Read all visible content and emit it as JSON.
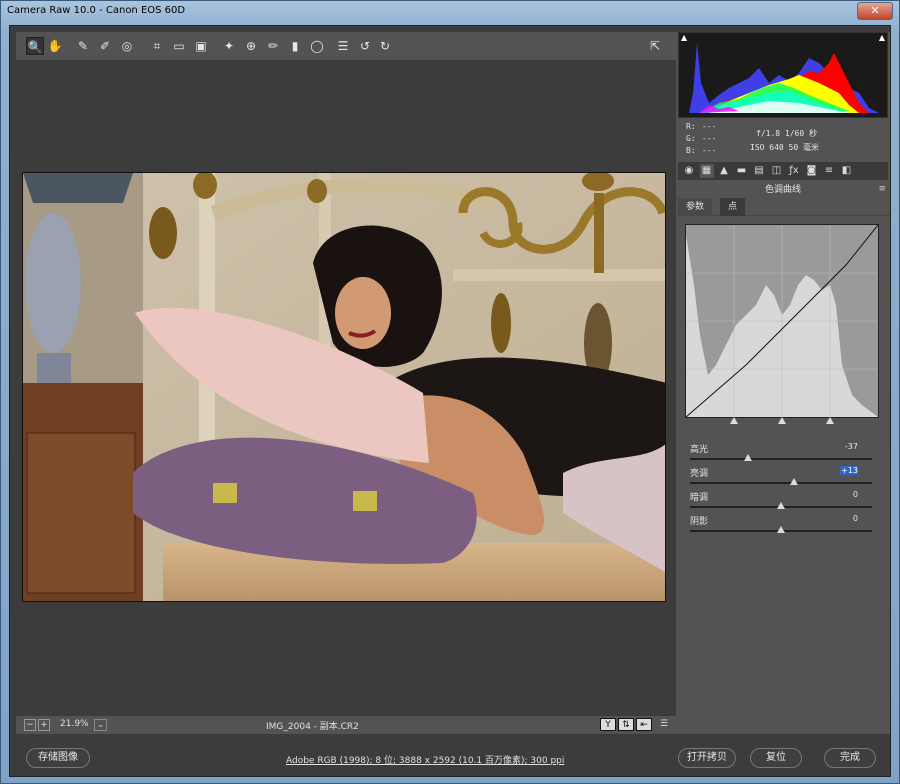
{
  "window": {
    "title": "Camera Raw 10.0 - Canon EOS 60D",
    "close_glyph": "✕"
  },
  "toolbar": {
    "tools": [
      "zoom-icon",
      "hand-icon",
      "white-balance-icon",
      "color-sampler-icon",
      "target-adjust-icon",
      "crop-icon",
      "straighten-icon",
      "transform-icon",
      "spot-removal-icon",
      "red-eye-icon",
      "adjustment-brush-icon",
      "graduated-filter-icon",
      "radial-filter-icon",
      "preferences-icon",
      "rotate-left-icon",
      "rotate-right-icon"
    ],
    "glyphs": [
      "🔍",
      "✋",
      "✎",
      "✐",
      "◎",
      "⌗",
      "▭",
      "▣",
      "✦",
      "⊕",
      "✏",
      "▮",
      "◯",
      "☰",
      "↺",
      "↻"
    ],
    "fullscreen_glyph": "⇱"
  },
  "status": {
    "zoom": "21.9%",
    "filename": "IMG_2004 - 副本.CR2",
    "view_y_label": "Y"
  },
  "histogram": {
    "colors": [
      "#ff0000",
      "#ffff00",
      "#00ff00",
      "#00ffff",
      "#0000ff",
      "#ff00ff",
      "#ffffff"
    ]
  },
  "info": {
    "r_label": "R:",
    "r_val": "---",
    "g_label": "G:",
    "g_val": "---",
    "b_label": "B:",
    "b_val": "---",
    "aperture_shutter": "f/1.8  1/60 秒",
    "iso_focal": "ISO 640  50 毫米"
  },
  "panel_tabs": [
    "◉",
    "▦",
    "▲",
    "▬",
    "▤",
    "◫",
    "ƒx",
    "◙",
    "≡",
    "◧"
  ],
  "panel": {
    "title": "色调曲线",
    "subtab_param": "参数",
    "subtab_point": "点",
    "sliders": [
      {
        "label": "高光",
        "value": "-37",
        "level": 0.32
      },
      {
        "label": "亮调",
        "value": "+13",
        "level": 0.57,
        "selected": true
      },
      {
        "label": "暗调",
        "value": "0",
        "level": 0.5
      },
      {
        "label": "阴影",
        "value": "0",
        "level": 0.5
      }
    ]
  },
  "buttons": {
    "save": "存储图像",
    "open_copy": "打开拷贝",
    "reset": "复位",
    "done": "完成"
  },
  "workflow": "Adobe RGB (1998); 8 位; 3888 x 2592 (10.1 百万像素); 300 ppi"
}
